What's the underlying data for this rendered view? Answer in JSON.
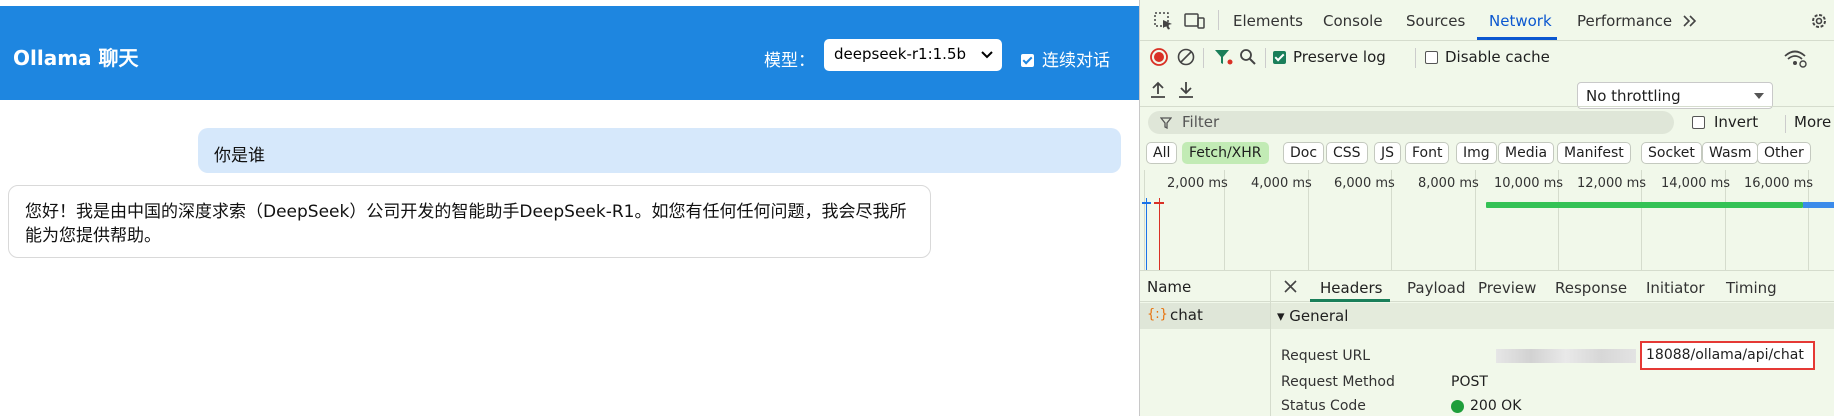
{
  "app": {
    "title": "Ollama 聊天",
    "model_label": "模型：",
    "model_value": "deepseek-r1:1.5b",
    "continuous_label": "连续对话",
    "continuous_checked": true
  },
  "messages": [
    {
      "role": "user",
      "text": "你是谁"
    },
    {
      "role": "assistant",
      "text": "您好！我是由中国的深度求索（DeepSeek）公司开发的智能助手DeepSeek-R1。如您有任何任何问题，我会尽我所能为您提供帮助。"
    }
  ],
  "devtools": {
    "tabs": [
      "Elements",
      "Console",
      "Sources",
      "Network",
      "Performance"
    ],
    "active_tab": "Network",
    "preserve_log_label": "Preserve log",
    "preserve_log_checked": true,
    "disable_cache_label": "Disable cache",
    "disable_cache_checked": false,
    "throttling": "No throttling",
    "filter_placeholder": "Filter",
    "invert_label": "Invert",
    "more_label": "More",
    "type_filters": [
      "All",
      "Fetch/XHR",
      "Doc",
      "CSS",
      "JS",
      "Font",
      "Img",
      "Media",
      "Manifest",
      "Socket",
      "Wasm",
      "Other"
    ],
    "active_type_filter": "Fetch/XHR",
    "timeline_ticks": [
      "2,000 ms",
      "4,000 ms",
      "6,000 ms",
      "8,000 ms",
      "10,000 ms",
      "12,000 ms",
      "14,000 ms",
      "16,000 ms"
    ],
    "name_header": "Name",
    "requests": [
      {
        "name": "chat"
      }
    ],
    "detail_tabs": [
      "Headers",
      "Payload",
      "Preview",
      "Response",
      "Initiator",
      "Timing"
    ],
    "active_detail_tab": "Headers",
    "general_label": "▾ General",
    "request_url_label": "Request URL",
    "request_url_value": "18088/ollama/api/chat",
    "request_method_label": "Request Method",
    "request_method_value": "POST",
    "status_code_label": "Status Code",
    "status_code_value": "200 OK",
    "colors": {
      "status_ok": "#1e9e3a",
      "accent": "#0b57d0",
      "app_header": "#1e86e0"
    }
  }
}
